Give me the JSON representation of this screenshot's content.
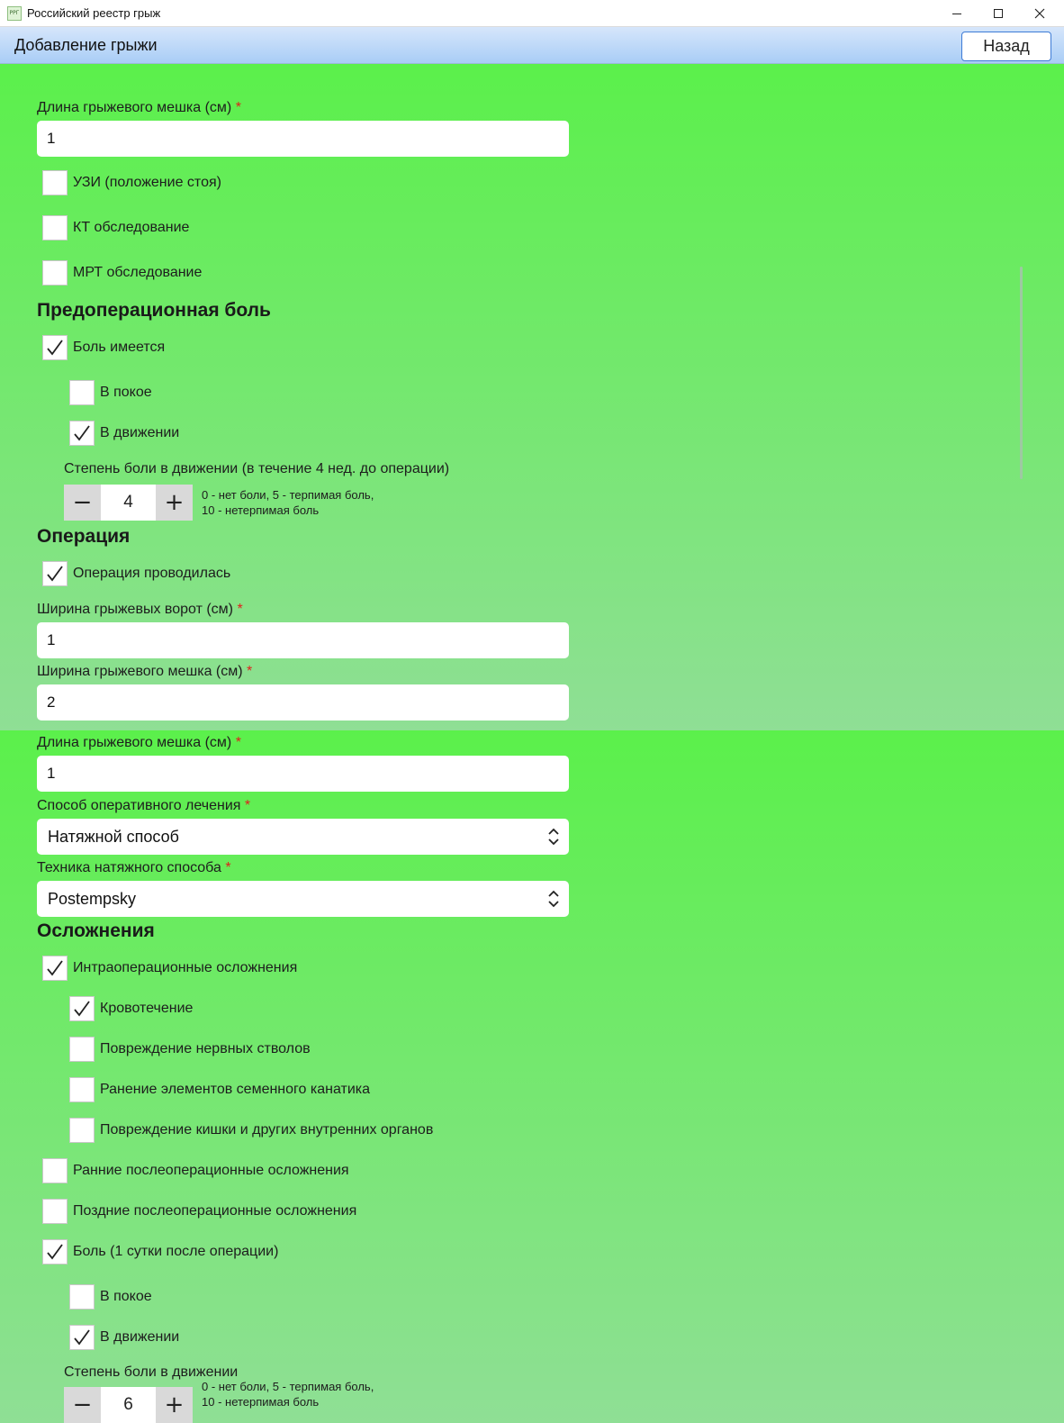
{
  "window": {
    "icon_text": "РРГ",
    "title": "Российский реестр грыж"
  },
  "header": {
    "title": "Добавление грыжи",
    "back_label": "Назад"
  },
  "top": {
    "sac_length_label": "Длина грыжевого мешка (см)",
    "sac_length_value": "1",
    "us_label": "УЗИ (положение стоя)",
    "ct_label": "КТ обследование",
    "mri_label": "МРТ обследование",
    "preop_pain_title": "Предоперационная боль",
    "pain_present_label": "Боль имеется",
    "rest_label": "В покое",
    "motion_label": "В движении",
    "pain_degree_label": "Степень боли в движении (в течение 4 нед. до операции)",
    "pain_degree_value": "4",
    "pain_hint_line1": "0 - нет боли, 5 - терпимая боль,",
    "pain_hint_line2": "10 - нетерпимая боль",
    "operation_title": "Операция",
    "operation_done_label": "Операция проводилась",
    "gate_width_label": "Ширина грыжевых ворот (см)",
    "gate_width_value": "1",
    "sac_width_label": "Ширина грыжевого мешка (см)",
    "sac_width_value": "2"
  },
  "bottom": {
    "sac_length_label": "Длина грыжевого мешка (см)",
    "sac_length_value": "1",
    "method_label": "Способ оперативного лечения",
    "method_value": "Натяжной способ",
    "technique_label": "Техника натяжного способа",
    "technique_value": "Postempsky",
    "complications_title": "Осложнения",
    "intraop_label": "Интраоперационные осложнения",
    "bleeding_label": "Кровотечение",
    "nerve_label": "Повреждение нервных стволов",
    "cord_label": "Ранение элементов семенного канатика",
    "bowel_label": "Повреждение кишки и других внутренних органов",
    "early_label": "Ранние послеоперационные осложнения",
    "late_label": "Поздние послеоперационные осложнения",
    "postop_pain_label": "Боль (1 сутки после операции)",
    "rest_label": "В покое",
    "motion_label": "В движении",
    "pain_degree_label": "Степень боли в движении",
    "pain_degree_value": "6",
    "pain_hint_line1": "0 - нет боли, 5 - терпимая боль,",
    "pain_hint_line2": "10 - нетерпимая боль"
  },
  "required_mark": "*",
  "stepper": {
    "minus": "−",
    "plus": "+"
  },
  "checkbox_states": {
    "us": false,
    "ct": false,
    "mri": false,
    "pain_present": true,
    "pre_rest": false,
    "pre_motion": true,
    "operation_done": true,
    "intraop": true,
    "bleeding": true,
    "nerve": false,
    "cord": false,
    "bowel": false,
    "early": false,
    "late": false,
    "postop_pain": true,
    "post_rest": false,
    "post_motion": true
  },
  "colors": {
    "panel_top": "#5bf04b",
    "panel_bottom": "#8fdf95",
    "required": "#e0201c",
    "header_from": "#d6e6fb",
    "header_to": "#a9cdf6"
  }
}
